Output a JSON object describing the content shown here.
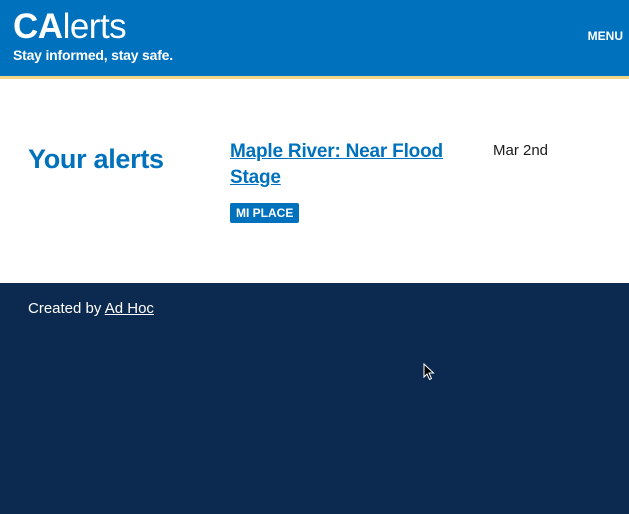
{
  "header": {
    "logo_bold": "CA",
    "logo_light": "lerts",
    "tagline": "Stay informed, stay safe.",
    "menu_label": "MENU"
  },
  "main": {
    "title": "Your alerts",
    "alerts": [
      {
        "title": "Maple River: Near Flood Stage",
        "tag": "MI PLACE",
        "date": "Mar 2nd"
      }
    ]
  },
  "footer": {
    "created_by_prefix": "Created by ",
    "created_by_link": "Ad Hoc"
  },
  "colors": {
    "header_bg": "#0071bc",
    "header_stripe": "#f2d68a",
    "footer_bg": "#0c2a4f",
    "accent": "#0071bc"
  },
  "icons": {
    "cursor": "mouse-pointer-icon"
  }
}
